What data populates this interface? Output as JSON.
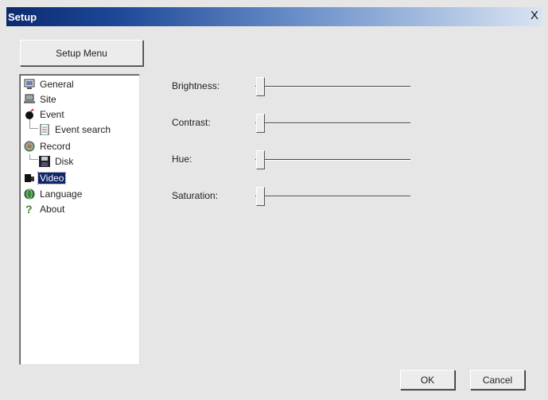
{
  "window": {
    "title": "Setup",
    "close_glyph": "X"
  },
  "setup_menu_label": "Setup Menu",
  "tree": [
    {
      "label": "General",
      "icon": "monitor-icon"
    },
    {
      "label": "Site",
      "icon": "computer-icon"
    },
    {
      "label": "Event",
      "icon": "bomb-icon"
    },
    {
      "label": "Event search",
      "icon": "document-icon"
    },
    {
      "label": "Record",
      "icon": "record-icon"
    },
    {
      "label": "Disk",
      "icon": "floppy-disk-icon"
    },
    {
      "label": "Video",
      "icon": "video-icon",
      "selected": true
    },
    {
      "label": "Language",
      "icon": "globe-icon"
    },
    {
      "label": "About",
      "icon": "question-icon"
    }
  ],
  "settings": [
    {
      "label": "Brightness:",
      "level": 0
    },
    {
      "label": "Contrast:",
      "level": 0
    },
    {
      "label": "Hue:",
      "level": 0
    },
    {
      "label": "Saturation:",
      "level": 0
    }
  ],
  "buttons": {
    "ok": "OK",
    "cancel": "Cancel"
  }
}
